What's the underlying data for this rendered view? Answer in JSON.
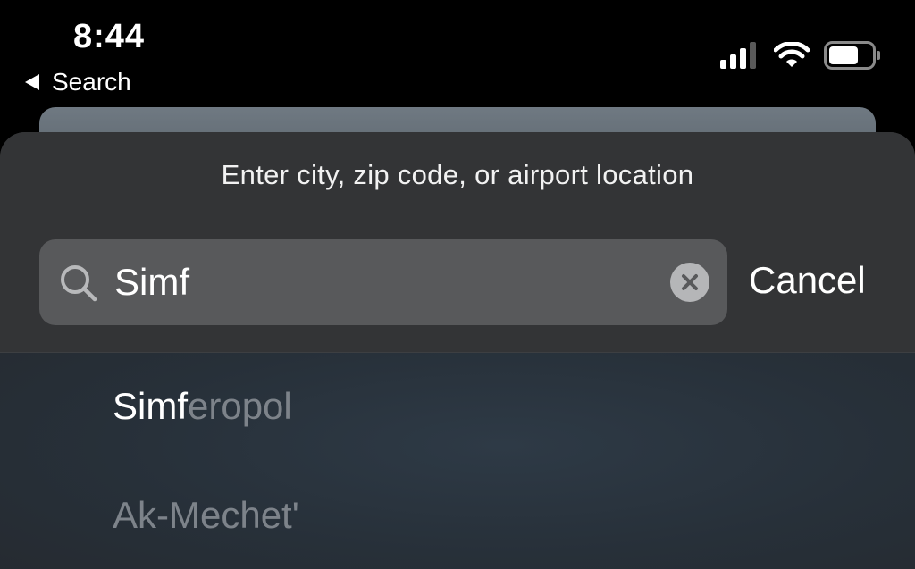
{
  "status_bar": {
    "time": "8:44",
    "back_label": "Search",
    "signal": "signal-icon",
    "wifi": "wifi-icon",
    "battery": "battery-icon"
  },
  "search_sheet": {
    "prompt": "Enter city, zip code, or airport location",
    "search": {
      "value": "Simf",
      "placeholder": ""
    },
    "cancel_label": "Cancel"
  },
  "results": [
    {
      "match": "Simf",
      "rest": "eropol"
    },
    {
      "match": "",
      "rest": "Ak-Mechet'"
    }
  ],
  "colors": {
    "sheet_background": "#333436",
    "search_field": "#58595b",
    "muted_text": "#7d838a"
  }
}
